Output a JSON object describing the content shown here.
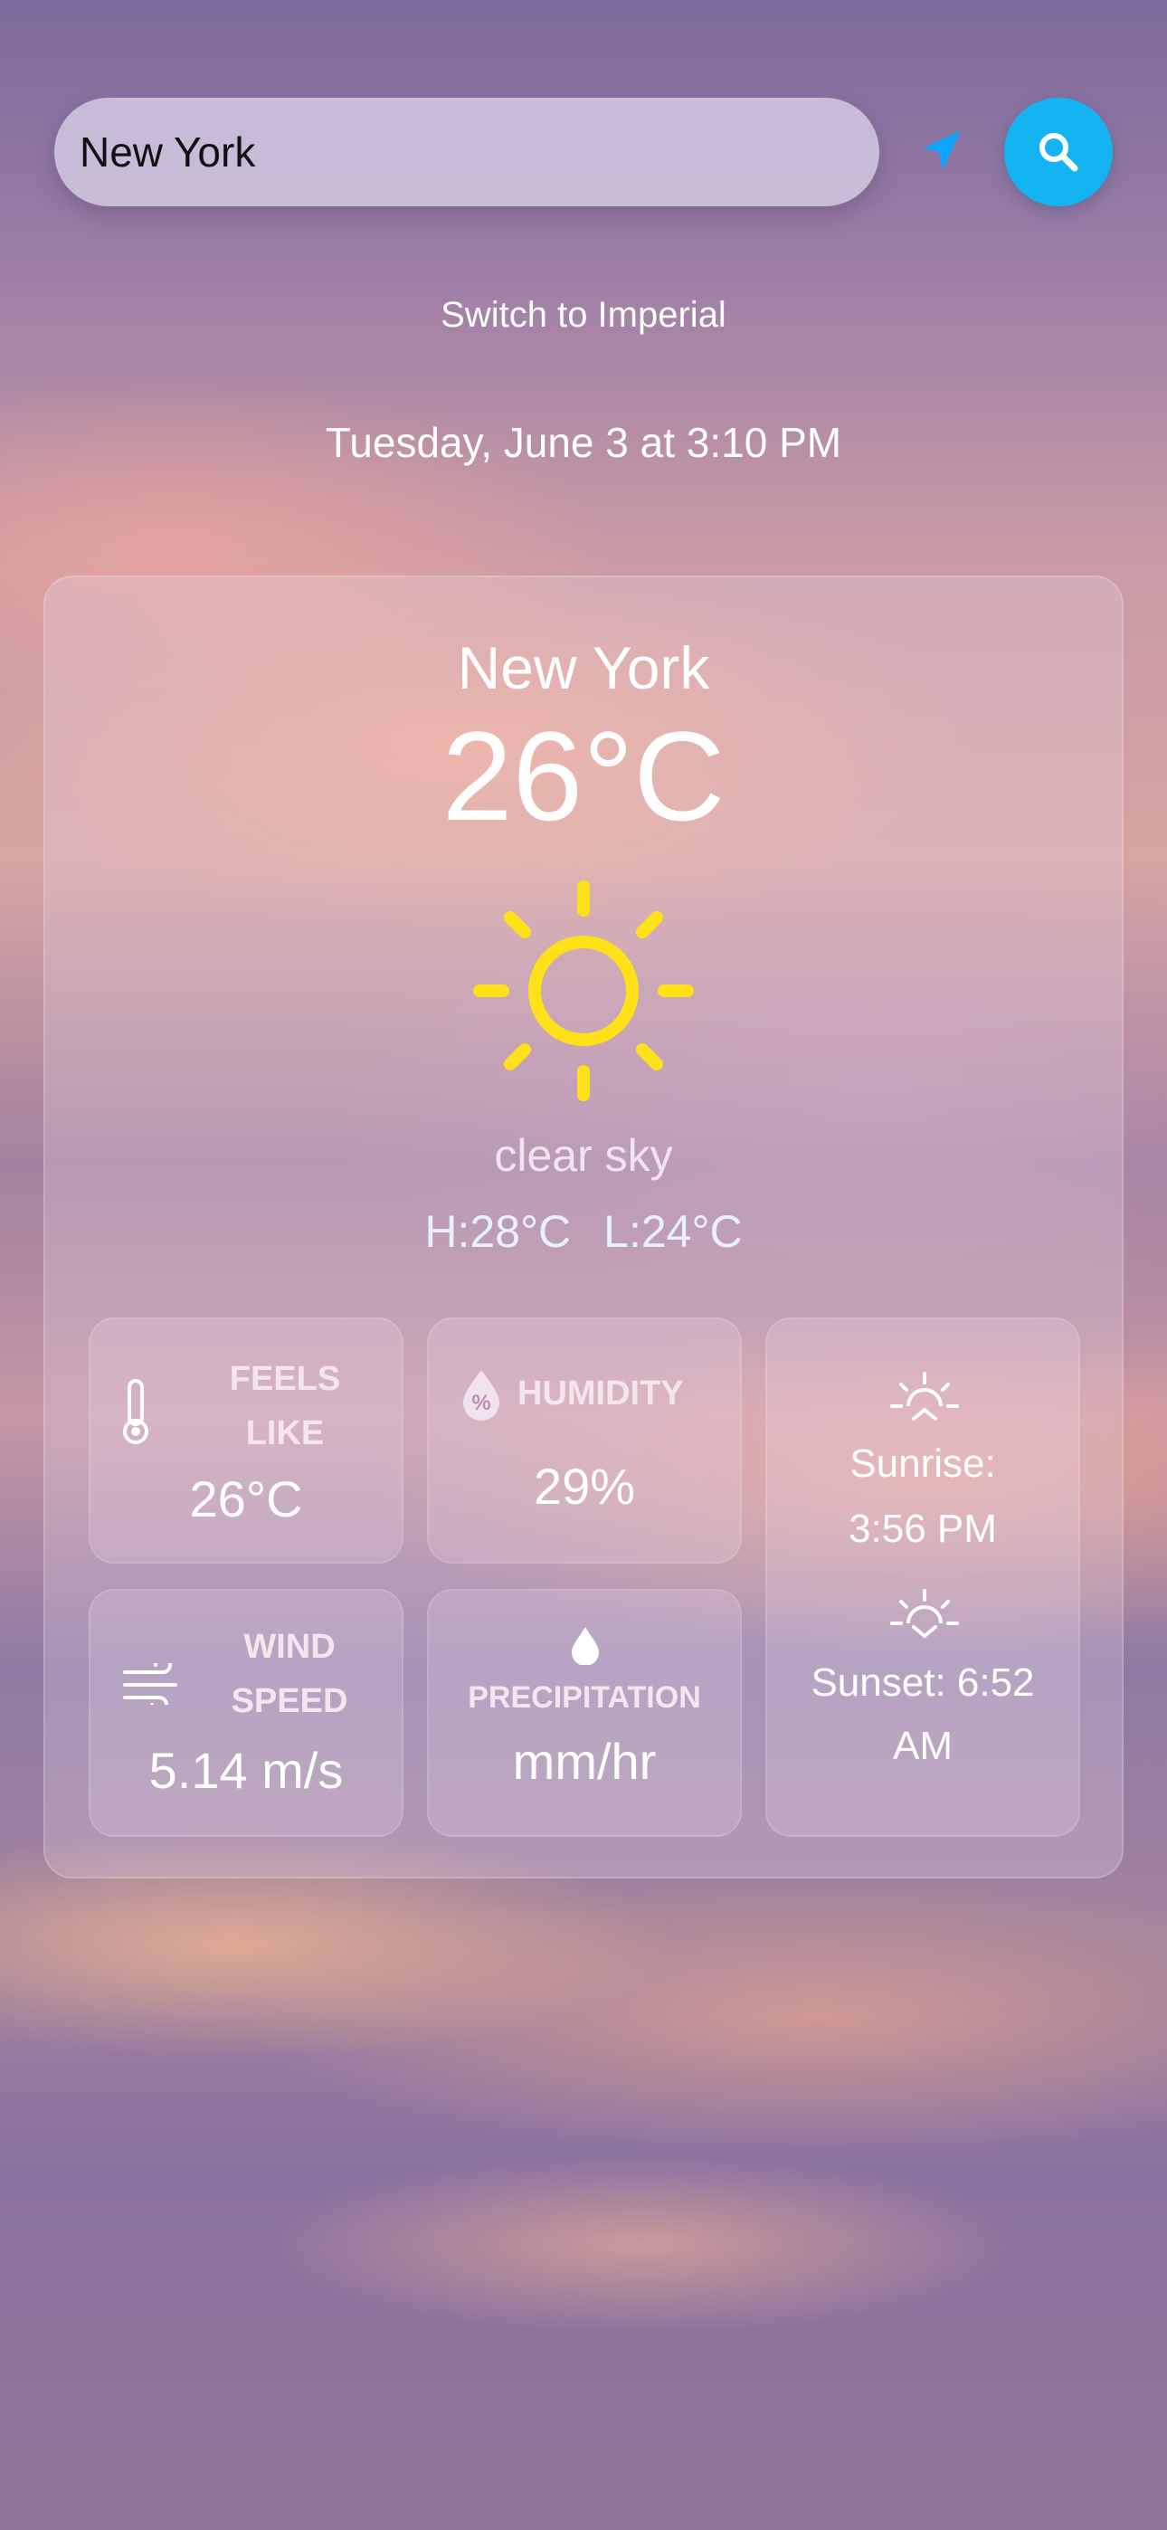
{
  "search": {
    "value": "New York"
  },
  "units": {
    "toggle_label": "Switch to Imperial"
  },
  "datetime": "Tuesday, June 3 at 3:10 PM",
  "current": {
    "city": "New York",
    "temperature": "26°C",
    "description": "clear sky",
    "high": "H:28°C",
    "low": "L:24°C"
  },
  "tiles": {
    "feels_like": {
      "label": "FEELS LIKE",
      "value": "26°C",
      "icon": "thermometer-icon"
    },
    "humidity": {
      "label": "HUMIDITY",
      "value": "29%",
      "icon": "humidity-icon"
    },
    "wind": {
      "label": "WIND SPEED",
      "value": "5.14 m/s",
      "icon": "wind-icon"
    },
    "precipitation": {
      "label": "PRECIPITATION",
      "value": "mm/hr",
      "icon": "droplet-icon"
    },
    "sun": {
      "sunrise_label": "Sunrise:",
      "sunrise_time": "3:56 PM",
      "sunset_label": "Sunset: 6:52",
      "sunset_time": "AM"
    }
  },
  "colors": {
    "accent": "#14b4f2",
    "sun": "#ffe11a",
    "location": "#0ea5ff"
  }
}
